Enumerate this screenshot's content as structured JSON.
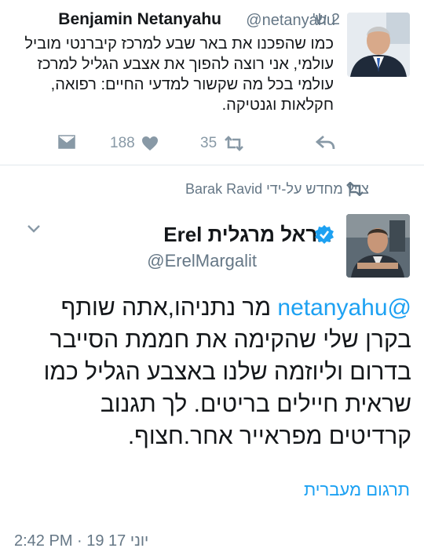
{
  "top_tweet": {
    "author_name": "Benjamin Netanyahu",
    "author_handle": "@netanyahu",
    "time_ago": "2 ש'",
    "text": "כמו שהפכנו את באר שבע למרכז קיברנטי מוביל עולמי, אני רוצה להפוך את אצבע הגליל למרכז עולמי בכל מה שקשור למדעי החיים: רפואה, חקלאות וגנטיקה.",
    "like_count": "188",
    "retweet_count": "35",
    "icons": [
      "direct-message-icon",
      "like-icon",
      "retweet-icon",
      "reply-icon"
    ]
  },
  "retweet_context": {
    "text": "צויץ מחדש על-ידי Barak Ravid",
    "icon": "retweet-icon"
  },
  "main_tweet": {
    "author_name": "אראל מרגלית Erel",
    "author_handle": "@ErelMargalit",
    "mention": "@netanyahu",
    "text_after_mention": " מר נתניהו,אתה שותף בקרן שלי שהקימה את חממת הסייבר בדרום וליוזמה שלנו באצבע הגליל כמו שראית חיילים בריטים. לך תגנוב קרדיטים מפראייר אחר.חצוף.",
    "translate_label": "תרגום מעברית",
    "timestamp": "2:42 PM · 19 17 יוני",
    "icons": [
      "verified-badge-icon",
      "chevron-down-icon"
    ]
  },
  "colors": {
    "accent": "#1da1f2",
    "text": "#14171a",
    "secondary_text": "#657786",
    "icon_gray": "#8899a6",
    "divider": "#e1e8ed"
  }
}
